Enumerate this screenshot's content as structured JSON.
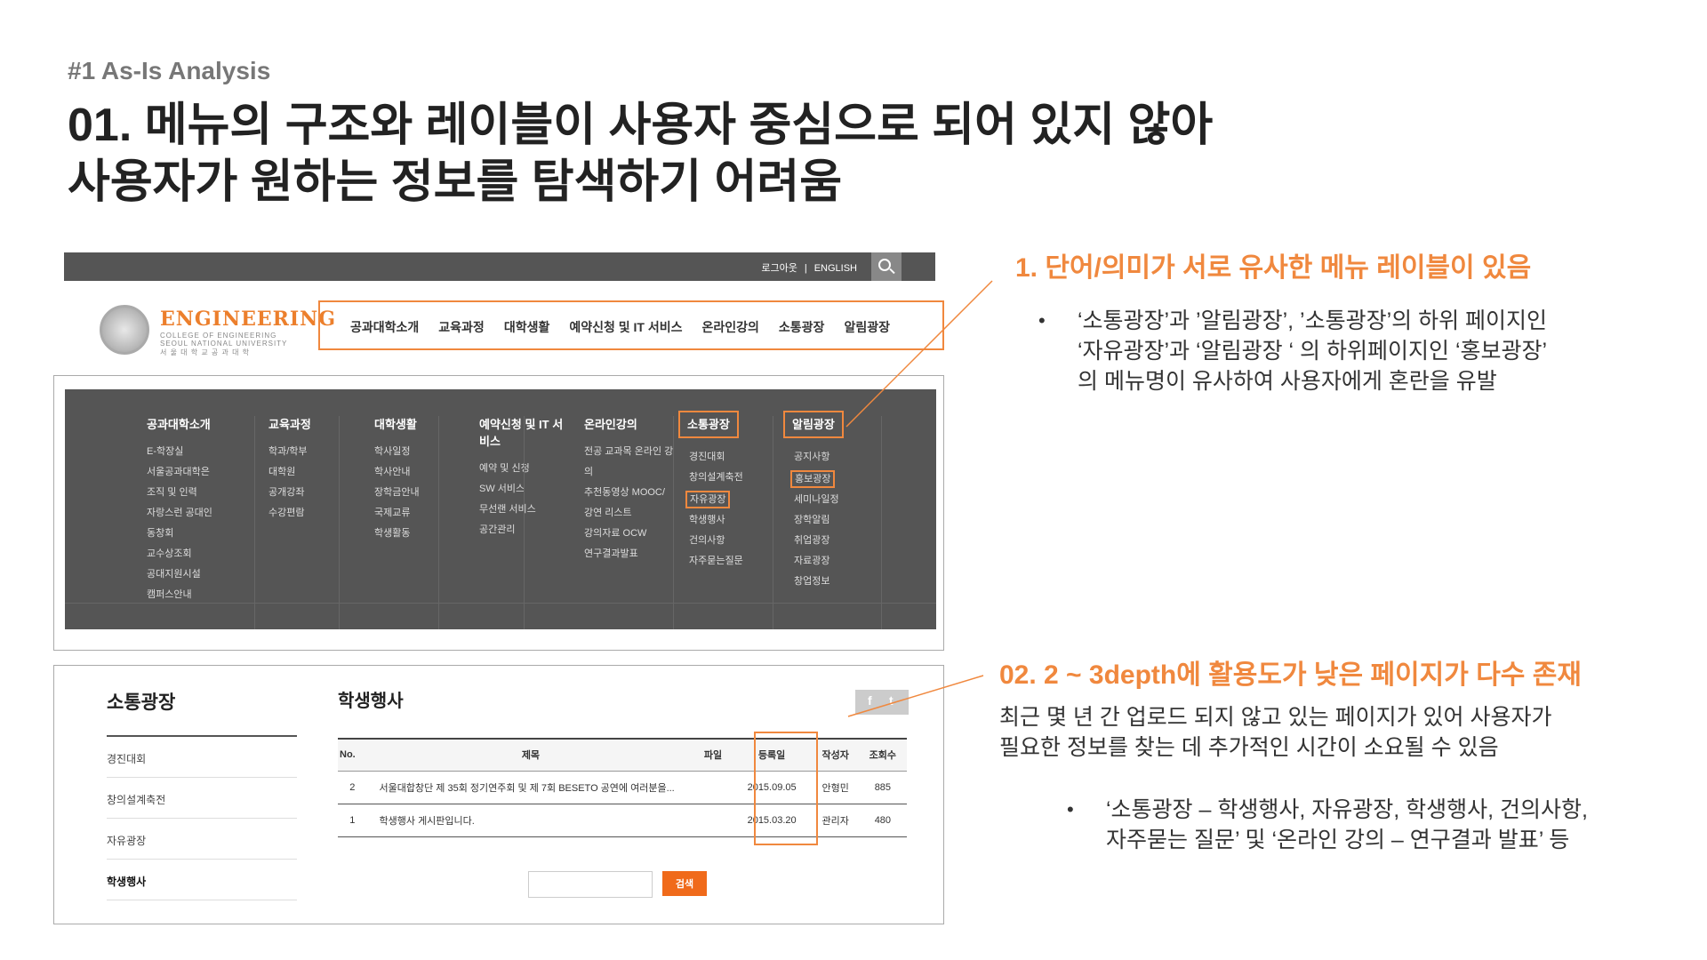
{
  "slide": {
    "section_label": "#1 As-Is Analysis",
    "headline_line1": "01. 메뉴의 구조와 레이블이 사용자 중심으로 되어 있지 않아",
    "headline_line2": "사용자가 원하는 정보를 탐색하기 어려움"
  },
  "site_header": {
    "top_links": [
      "로그아웃",
      "|",
      "ENGLISH"
    ],
    "logo": {
      "wordmark": "ENGINEERING",
      "line1": "COLLEGE OF ENGINEERING",
      "line2": "SEOUL NATIONAL UNIVERSITY",
      "line3": "서 울 대 학 교 공 과 대 학"
    },
    "gnb": [
      "공과대학소개",
      "교육과정",
      "대학생활",
      "예약신청 및 IT 서비스",
      "온라인강의",
      "소통광장",
      "알림광장"
    ]
  },
  "mega_menu": [
    {
      "title": "공과대학소개",
      "items": [
        "E-학장실",
        "서울공과대학은",
        "조직 및 인력",
        "자랑스런 공대인",
        "동창회",
        "교수상조회",
        "공대지원시설",
        "캠퍼스안내"
      ]
    },
    {
      "title": "교육과정",
      "items": [
        "학과/학부",
        "대학원",
        "공개강좌",
        "수강편람"
      ]
    },
    {
      "title": "대학생활",
      "items": [
        "학사일정",
        "학사안내",
        "장학금안내",
        "국제교류",
        "학생활동"
      ]
    },
    {
      "title_line1": "예약신청 및 IT 서",
      "title_line2": "비스",
      "items": [
        "예약 및 신청",
        "SW 서비스",
        "무선랜 서비스",
        "공간관리"
      ]
    },
    {
      "title": "온라인강의",
      "items": [
        "전공 교과목 온라인 강",
        "의",
        "추천동영상 MOOC/",
        "강연 리스트",
        "강의자료 OCW",
        "연구결과발표"
      ]
    },
    {
      "title": "소통광장",
      "items": [
        "경진대회",
        "창의설계축전",
        "자유광장",
        "학생행사",
        "건의사항",
        "자주묻는질문"
      ]
    },
    {
      "title": "알림광장",
      "items": [
        "공지사항",
        "홍보광장",
        "세미나일정",
        "장학알림",
        "취업광장",
        "자료광장",
        "창업정보"
      ]
    }
  ],
  "board_page": {
    "lnb_title": "소통광장",
    "lnb_items": [
      "경진대회",
      "창의설계축전",
      "자유광장",
      "학생행사"
    ],
    "board_title": "학생행사",
    "sns": [
      "f",
      "t"
    ],
    "columns": [
      "No.",
      "제목",
      "파일",
      "등록일",
      "작성자",
      "조회수"
    ],
    "rows": [
      {
        "no": "2",
        "subject": "서울대합창단 제 35회 정기연주회 및 제 7회 BESETO 공연에 여러분을...",
        "file": "",
        "date": "2015.09.05",
        "author": "안형민",
        "views": "885"
      },
      {
        "no": "1",
        "subject": "학생행사 게시판입니다.",
        "file": "",
        "date": "2015.03.20",
        "author": "관리자",
        "views": "480"
      }
    ],
    "search_button": "검색",
    "search_value": ""
  },
  "annotation_1": {
    "heading": "1. 단어/의미가 서로 유사한 메뉴 레이블이 있음",
    "bullet": "•",
    "line1": "‘소통광장’과 ’알림광장’, ’소통광장’의 하위 페이지인",
    "line2": "‘자유광장’과 ‘알림광장 ‘ 의 하위페이지인 ‘홍보광장’",
    "line3": "의 메뉴명이 유사하여 사용자에게 혼란을 유발"
  },
  "annotation_2": {
    "heading": "02. 2 ~ 3depth에 활용도가 낮은 페이지가 다수 존재",
    "body_line1": "최근 몇 년 간 업로드 되지 않고 있는 페이지가 있어 사용자가",
    "body_line2": "필요한 정보를 찾는 데 추가적인 시간이 소요될 수 있음",
    "bullet": "•",
    "line1": "‘소통광장 – 학생행사, 자유광장, 학생행사, 건의사항,",
    "line2": "자주묻는 질문’ 및 ‘온라인 강의 – 연구결과 발표’  등"
  },
  "colors": {
    "accent": "#f0883e",
    "dark_bar": "#555555",
    "search_btn": "#f06a1a"
  }
}
